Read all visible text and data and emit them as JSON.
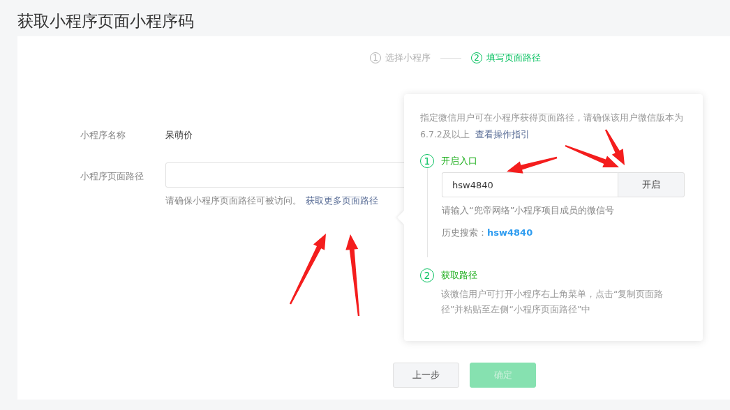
{
  "page": {
    "title": "获取小程序页面小程序码"
  },
  "steps": [
    {
      "number": "1",
      "label": "选择小程序",
      "selected": false
    },
    {
      "number": "2",
      "label": "填写页面路径",
      "selected": true
    }
  ],
  "form": {
    "name_label": "小程序名称",
    "name_value": "呆萌价",
    "path_label": "小程序页面路径",
    "path_hint": "请确保小程序页面路径可被访问。",
    "path_link": "获取更多页面路径"
  },
  "popover": {
    "intro": "指定微信用户可在小程序获得页面路径，请确保该用户微信版本为6.7.2及以上",
    "intro_link": "查看操作指引",
    "steps": [
      {
        "number": "1",
        "title": "开启入口",
        "input_value": "hsw4840",
        "button": "开启",
        "hint": "请输入“兜帝网络”小程序项目成员的微信号",
        "history_label": "历史搜索：",
        "history_value": "hsw4840"
      },
      {
        "number": "2",
        "title": "获取路径",
        "text": "该微信用户可打开小程序右上角菜单，点击“复制页面路径”并粘贴至左侧“小程序页面路径”中"
      }
    ]
  },
  "buttons": [
    {
      "label": "上一步",
      "kind": "default",
      "disabled": false
    },
    {
      "label": "确定",
      "kind": "primary",
      "disabled": true
    }
  ]
}
